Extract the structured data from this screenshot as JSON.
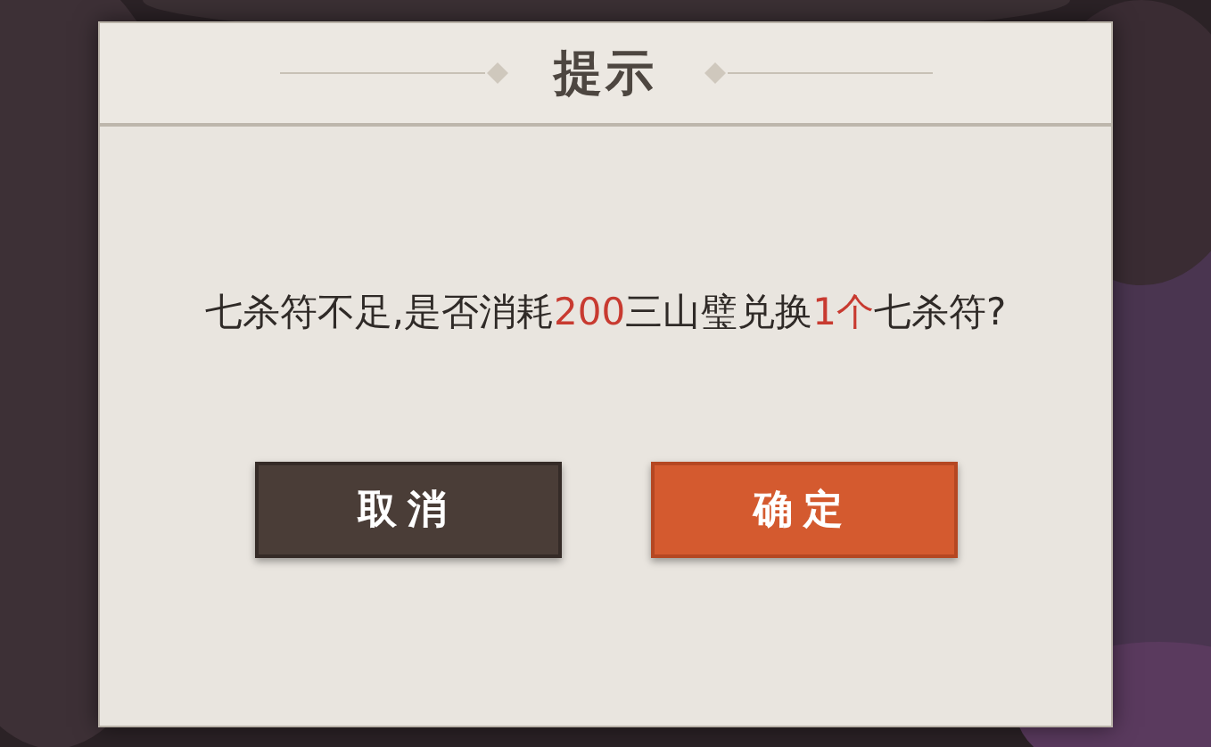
{
  "dialog": {
    "title": "提示",
    "message": [
      {
        "text": "七杀符不足,是否消耗",
        "highlight": false
      },
      {
        "text": "200",
        "highlight": true
      },
      {
        "text": "三山璧兑换",
        "highlight": false
      },
      {
        "text": "1个",
        "highlight": true
      },
      {
        "text": "七杀符?",
        "highlight": false
      }
    ],
    "buttons": [
      {
        "label": "取消",
        "kind": "secondary"
      },
      {
        "label": "确定",
        "kind": "primary"
      }
    ]
  }
}
